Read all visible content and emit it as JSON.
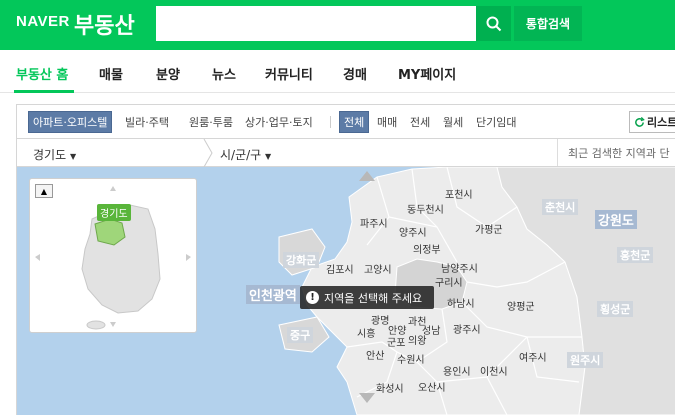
{
  "header": {
    "logo": "NAVER",
    "service": "부동산",
    "search_placeholder": "",
    "total_search": "통합검색"
  },
  "nav": {
    "items": [
      "부동산 홈",
      "매물",
      "분양",
      "뉴스",
      "커뮤니티",
      "경매",
      "MY페이지"
    ]
  },
  "filter": {
    "categories": [
      "아파트·오피스텔",
      "빌라·주택",
      "원룸·투룸",
      "상가·업무·토지"
    ],
    "deal_types": [
      "전체",
      "매매",
      "전세",
      "월세",
      "단기임대"
    ],
    "list_button": "리스트"
  },
  "location": {
    "province": "경기도",
    "city": "시/군/구",
    "recent": "최근 검색한 지역과 단"
  },
  "map": {
    "inset_label": "경기도",
    "tooltip": "지역을 선택해 주세요",
    "regions": {
      "incheon": "인천광역",
      "gangwon": "강원도",
      "ganghwa": "강화군",
      "junggu": "중구",
      "chuncheon": "춘천시",
      "hongcheon": "홍천군",
      "hoengseong": "횡성군",
      "wonju": "원주시"
    },
    "cities": {
      "pocheon": "포천시",
      "dongducheon": "동두천시",
      "paju": "파주시",
      "yangju": "양주시",
      "gapyeong": "가평군",
      "uijeongbu": "의정부",
      "gimpo": "김포시",
      "goyang": "고양시",
      "namyangju": "남양주시",
      "guri": "구리시",
      "hanam": "하남시",
      "yangpyeong": "양평군",
      "gwangmyeong": "광명",
      "gwacheon": "과천",
      "siheung": "시흥",
      "anyang": "안양",
      "seongnam": "성남",
      "gwangju": "광주시",
      "gunpo": "군포",
      "uiwang": "의왕",
      "ansan": "안산",
      "suwon": "수원시",
      "yongin": "용인시",
      "icheon": "이천시",
      "yeoju": "여주시",
      "hwaseong": "화성시",
      "osan": "오산시"
    }
  },
  "colors": {
    "brand": "#03c75a",
    "sea": "#b3d1ec",
    "land": "#e8e8e8",
    "selected_chip": "#5c7ba6"
  }
}
